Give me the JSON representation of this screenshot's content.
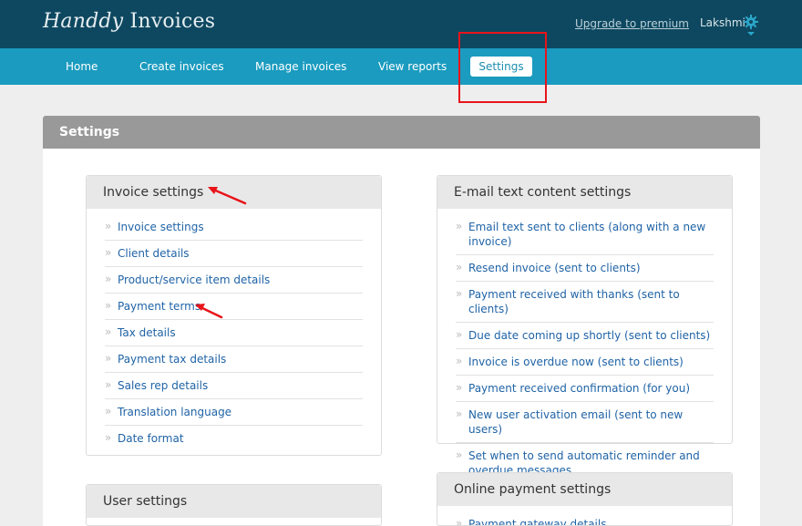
{
  "header": {
    "logo_script": "Handdy",
    "logo_word": "Invoices",
    "upgrade_link": "Upgrade to premium",
    "user_name": "Lakshmi"
  },
  "nav": {
    "items": [
      {
        "label": "Home"
      },
      {
        "label": "Create invoices"
      },
      {
        "label": "Manage invoices"
      },
      {
        "label": "View reports"
      },
      {
        "label": "Settings"
      }
    ],
    "active": "Settings"
  },
  "panel": {
    "title": "Settings"
  },
  "invoice_settings": {
    "title": "Invoice settings",
    "links": [
      "Invoice settings",
      "Client details",
      "Product/service item details",
      "Payment terms",
      "Tax details",
      "Payment tax details",
      "Sales rep details",
      "Translation language",
      "Date format"
    ]
  },
  "email_settings": {
    "title": "E-mail text content settings",
    "links": [
      "Email text sent to clients (along with a new invoice)",
      "Resend invoice (sent to clients)",
      "Payment received with thanks (sent to clients)",
      "Due date coming up shortly (sent to clients)",
      "Invoice is overdue now (sent to clients)",
      "Payment received confirmation (for you)",
      "New user activation email (sent to new users)",
      "Set when to send automatic reminder and overdue messages"
    ]
  },
  "user_settings": {
    "title": "User settings"
  },
  "online_payment_settings": {
    "title": "Online payment settings",
    "links": [
      "Payment gateway details"
    ]
  },
  "colors": {
    "topbar": "#0e4860",
    "navbar": "#1a9bbf",
    "link": "#1f63a6",
    "annotation": "#e8141a"
  }
}
